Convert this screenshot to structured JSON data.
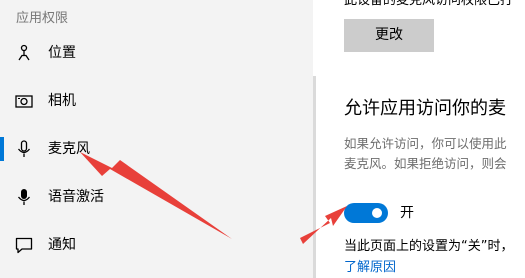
{
  "sidebar": {
    "header": "应用权限",
    "items": [
      {
        "label": "位置",
        "icon": "location-icon"
      },
      {
        "label": "相机",
        "icon": "camera-icon"
      },
      {
        "label": "麦克风",
        "icon": "microphone-icon",
        "selected": true
      },
      {
        "label": "语音激活",
        "icon": "voice-activation-icon"
      },
      {
        "label": "通知",
        "icon": "notification-icon"
      }
    ]
  },
  "main": {
    "top_text": "此设备的麦克风访问权限已打",
    "change_button": "更改",
    "section_heading": "允许应用访问你的麦",
    "description_lines": [
      "如果允许访问，你可以使用此",
      "麦克风。如果拒绝访问，则会"
    ],
    "toggle": {
      "state": "开",
      "on": true
    },
    "status_text": "当此页面上的设置为“关”时，",
    "learn_more": "了解原因"
  },
  "colors": {
    "accent": "#0078d7",
    "sidebar_bg": "#f3f3f3",
    "button_bg": "#cccccc",
    "link": "#0066cc",
    "annotation_arrow": "#e8403a"
  }
}
